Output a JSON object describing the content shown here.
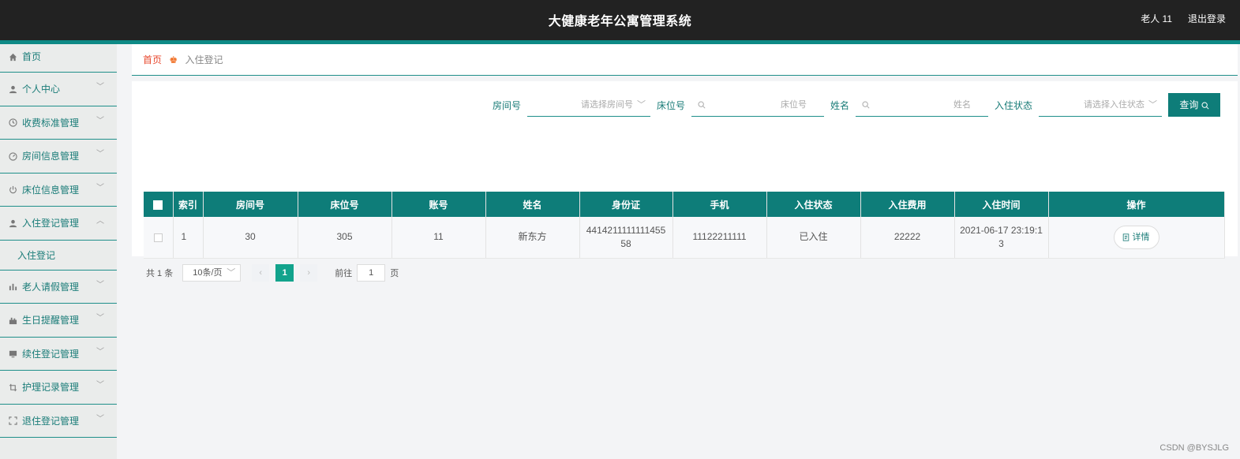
{
  "header": {
    "title": "大健康老年公寓管理系统",
    "user": "老人 11",
    "logout": "退出登录"
  },
  "sidebar": {
    "items": [
      {
        "label": "首页",
        "icon": "home-icon"
      },
      {
        "label": "个人中心",
        "icon": "user-icon"
      },
      {
        "label": "收费标准管理",
        "icon": "clock-icon"
      },
      {
        "label": "房间信息管理",
        "icon": "dashboard-icon"
      },
      {
        "label": "床位信息管理",
        "icon": "power-icon"
      },
      {
        "label": "入住登记管理",
        "icon": "user-icon",
        "expanded": true
      },
      {
        "label": "老人请假管理",
        "icon": "bar-chart-icon"
      },
      {
        "label": "生日提醒管理",
        "icon": "gift-icon"
      },
      {
        "label": "续住登记管理",
        "icon": "monitor-icon"
      },
      {
        "label": "护理记录管理",
        "icon": "crop-icon"
      },
      {
        "label": "退住登记管理",
        "icon": "fullscreen-icon"
      }
    ],
    "sub_item": "入住登记"
  },
  "breadcrumb": {
    "home": "首页",
    "current": "入住登记"
  },
  "filters": {
    "room_label": "房间号",
    "room_placeholder": "请选择房间号",
    "bed_label": "床位号",
    "bed_placeholder": "床位号",
    "name_label": "姓名",
    "name_placeholder": "姓名",
    "status_label": "入住状态",
    "status_placeholder": "请选择入住状态",
    "query_button": "查询"
  },
  "table": {
    "headers": [
      "索引",
      "房间号",
      "床位号",
      "账号",
      "姓名",
      "身份证",
      "手机",
      "入住状态",
      "入住费用",
      "入住时间",
      "操作"
    ],
    "rows": [
      {
        "index": "1",
        "room": "30",
        "bed": "305",
        "account": "11",
        "name": "新东方",
        "id_card": "441421111111145558",
        "phone": "11122211111",
        "status": "已入住",
        "fee": "22222",
        "time": "2021-06-17 23:19:13",
        "action": "详情"
      }
    ]
  },
  "pagination": {
    "total": "共 1 条",
    "page_size": "10条/页",
    "current_page": "1",
    "goto_prefix": "前往",
    "goto_value": "1",
    "goto_suffix": "页"
  },
  "watermark": "CSDN @BYSJLG",
  "colors": {
    "accent": "#0e7d79",
    "topbar": "#222222",
    "active_page": "#12a38c",
    "breadcrumb_home": "#e8492f"
  }
}
